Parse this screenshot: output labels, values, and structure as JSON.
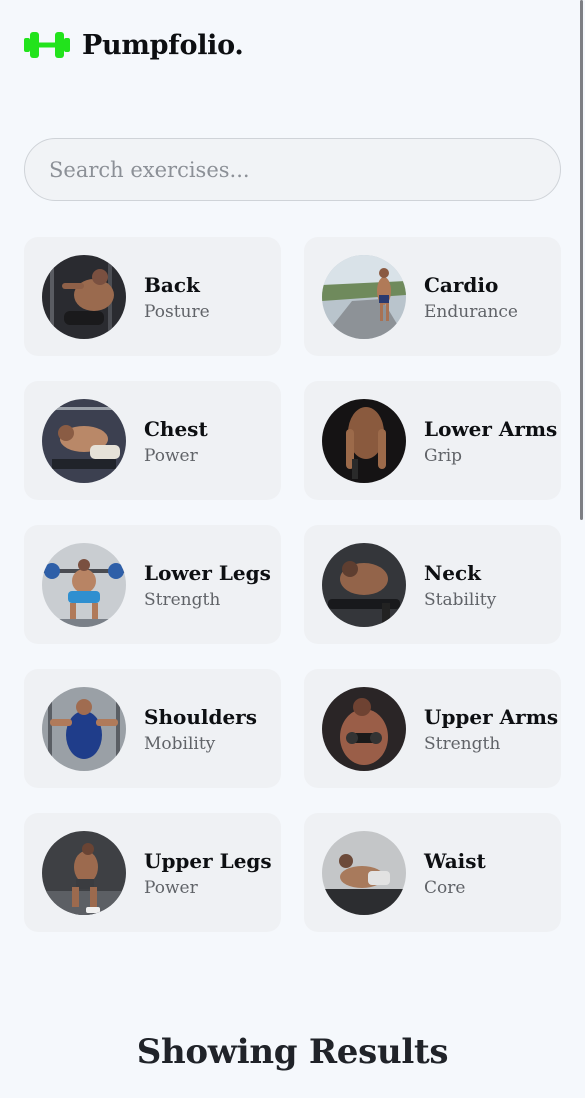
{
  "app": {
    "brand": "Pumpfolio.",
    "logo_icon": "dumbbell-icon",
    "accent_color": "#22e31c"
  },
  "search": {
    "placeholder": "Search exercises...",
    "value": ""
  },
  "categories": [
    {
      "title": "Back",
      "subtitle": "Posture",
      "icon": "back-photo"
    },
    {
      "title": "Cardio",
      "subtitle": "Endurance",
      "icon": "cardio-photo"
    },
    {
      "title": "Chest",
      "subtitle": "Power",
      "icon": "chest-photo"
    },
    {
      "title": "Lower Arms",
      "subtitle": "Grip",
      "icon": "lower-arms-photo"
    },
    {
      "title": "Lower Legs",
      "subtitle": "Strength",
      "icon": "lower-legs-photo"
    },
    {
      "title": "Neck",
      "subtitle": "Stability",
      "icon": "neck-photo"
    },
    {
      "title": "Shoulders",
      "subtitle": "Mobility",
      "icon": "shoulders-photo"
    },
    {
      "title": "Upper Arms",
      "subtitle": "Strength",
      "icon": "upper-arms-photo"
    },
    {
      "title": "Upper Legs",
      "subtitle": "Power",
      "icon": "upper-legs-photo"
    },
    {
      "title": "Waist",
      "subtitle": "Core",
      "icon": "waist-photo"
    }
  ],
  "results": {
    "heading": "Showing Results"
  }
}
